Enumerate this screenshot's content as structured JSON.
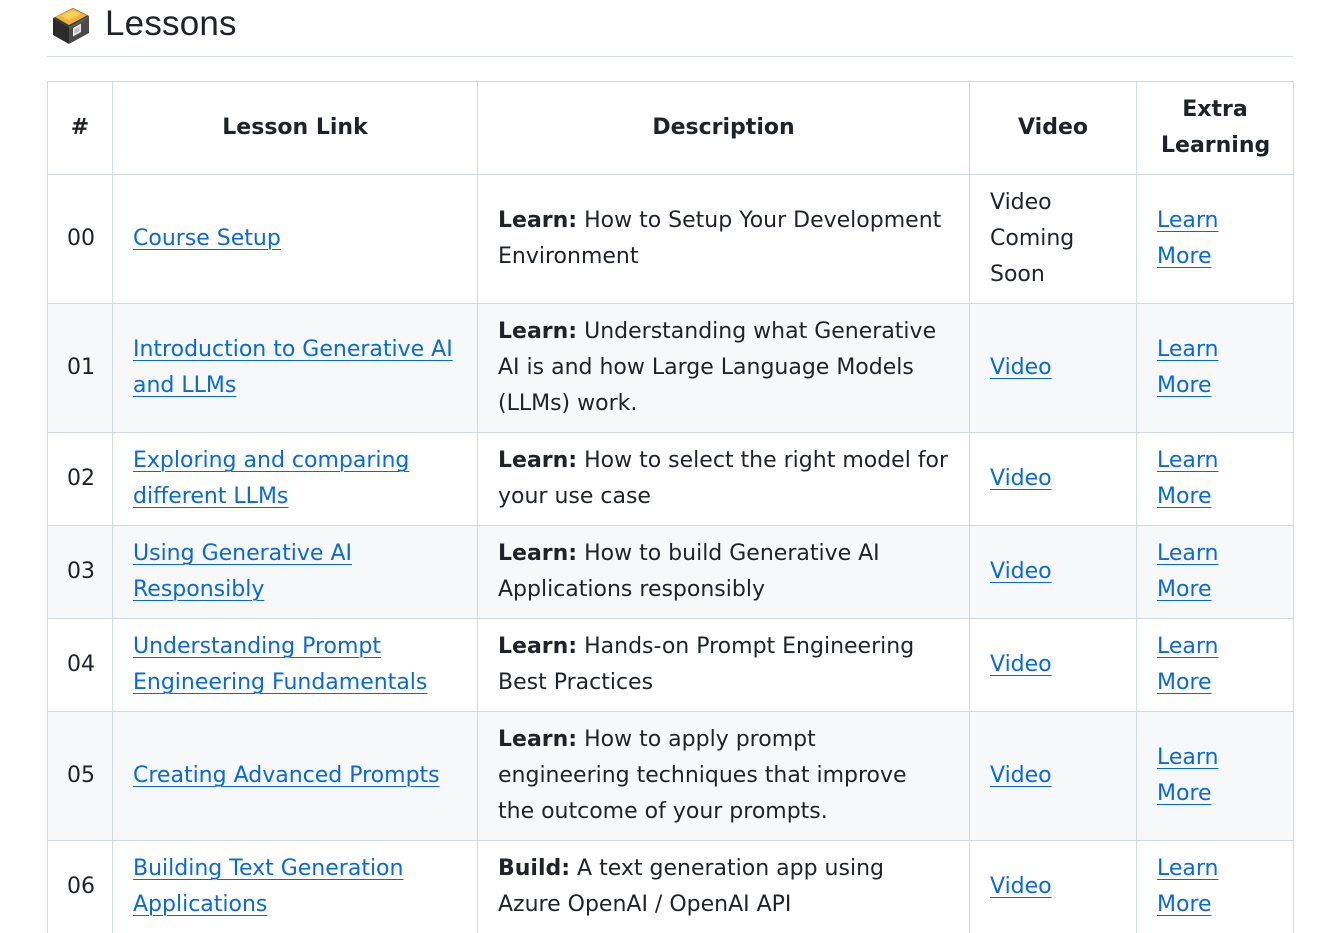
{
  "heading": {
    "title": "Lessons",
    "icon": "school-satchel-icon"
  },
  "table": {
    "headers": [
      "#",
      "Lesson Link",
      "Description",
      "Video",
      "Extra Learning"
    ],
    "rows": [
      {
        "num": "00",
        "lesson": "Course Setup",
        "desc_label": "Learn:",
        "desc_text": " How to Setup Your Development Environment",
        "video": "Video Coming Soon",
        "video_is_link": false,
        "extra": "Learn More"
      },
      {
        "num": "01",
        "lesson": "Introduction to Generative AI and LLMs",
        "desc_label": "Learn:",
        "desc_text": " Understanding what Generative AI is and how Large Language Models (LLMs) work.",
        "video": "Video",
        "video_is_link": true,
        "extra": "Learn More"
      },
      {
        "num": "02",
        "lesson": "Exploring and comparing different LLMs",
        "desc_label": "Learn:",
        "desc_text": " How to select the right model for your use case",
        "video": "Video",
        "video_is_link": true,
        "extra": "Learn More"
      },
      {
        "num": "03",
        "lesson": "Using Generative AI Responsibly",
        "desc_label": "Learn:",
        "desc_text": " How to build Generative AI Applications responsibly",
        "video": "Video",
        "video_is_link": true,
        "extra": "Learn More"
      },
      {
        "num": "04",
        "lesson": "Understanding Prompt Engineering Fundamentals",
        "desc_label": "Learn:",
        "desc_text": " Hands-on Prompt Engineering Best Practices",
        "video": "Video",
        "video_is_link": true,
        "extra": "Learn More"
      },
      {
        "num": "05",
        "lesson": "Creating Advanced Prompts",
        "desc_label": "Learn:",
        "desc_text": " How to apply prompt engineering techniques that improve the outcome of your prompts.",
        "video": "Video",
        "video_is_link": true,
        "extra": "Learn More"
      },
      {
        "num": "06",
        "lesson": "Building Text Generation Applications",
        "desc_label": "Build:",
        "desc_text": " A text generation app using Azure OpenAI / OpenAI API",
        "video": "Video",
        "video_is_link": true,
        "extra": "Learn More"
      }
    ]
  },
  "colors": {
    "link": "#0969da",
    "border": "#d1d9e0",
    "alt_row": "#f6f8fa",
    "text": "#1f2328"
  }
}
